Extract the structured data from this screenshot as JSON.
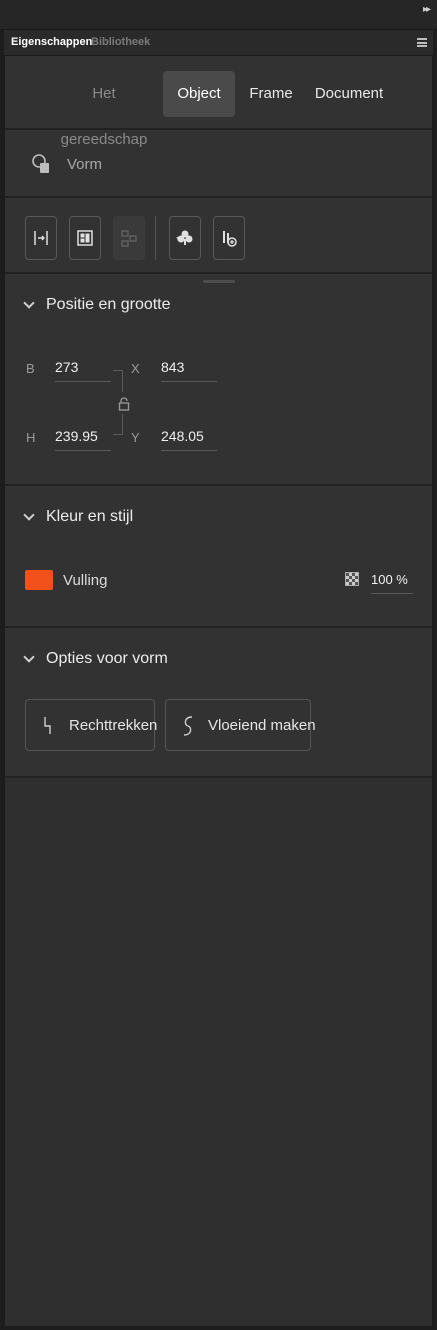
{
  "tabs": {
    "properties": "Eigenschappen",
    "library": "Bibliotheek"
  },
  "modes": [
    {
      "label": "Het gereedschap",
      "state": "dim"
    },
    {
      "label": "Object",
      "state": "selected"
    },
    {
      "label": "Frame",
      "state": "normal"
    },
    {
      "label": "Document",
      "state": "normal"
    }
  ],
  "object_type": {
    "label": "Vorm",
    "icon": "shape-icon"
  },
  "tools": [
    {
      "name": "fit-frame-icon",
      "enabled": true
    },
    {
      "name": "arrange-grid-icon",
      "enabled": true
    },
    {
      "name": "group-icon",
      "enabled": false
    },
    {
      "name": "asset-icon",
      "enabled": true
    },
    {
      "name": "link-asset-icon",
      "enabled": true
    }
  ],
  "position_size": {
    "title": "Positie en grootte",
    "width_label": "B",
    "width_value": "273",
    "height_label": "H",
    "height_value": "239.95",
    "x_label": "X",
    "x_value": "843",
    "y_label": "Y",
    "y_value": "248.05"
  },
  "color_style": {
    "title": "Kleur en stijl",
    "fill_label": "Vulling",
    "fill_color": "#f2511b",
    "opacity": "100 %"
  },
  "shape_options": {
    "title": "Opties voor vorm",
    "straighten": "Rechttrekken",
    "smooth": "Vloeiend maken"
  },
  "colors": {
    "accent_fill": "#f2511b",
    "panel": "#323232",
    "selected_mode": "#4a4a4a"
  }
}
